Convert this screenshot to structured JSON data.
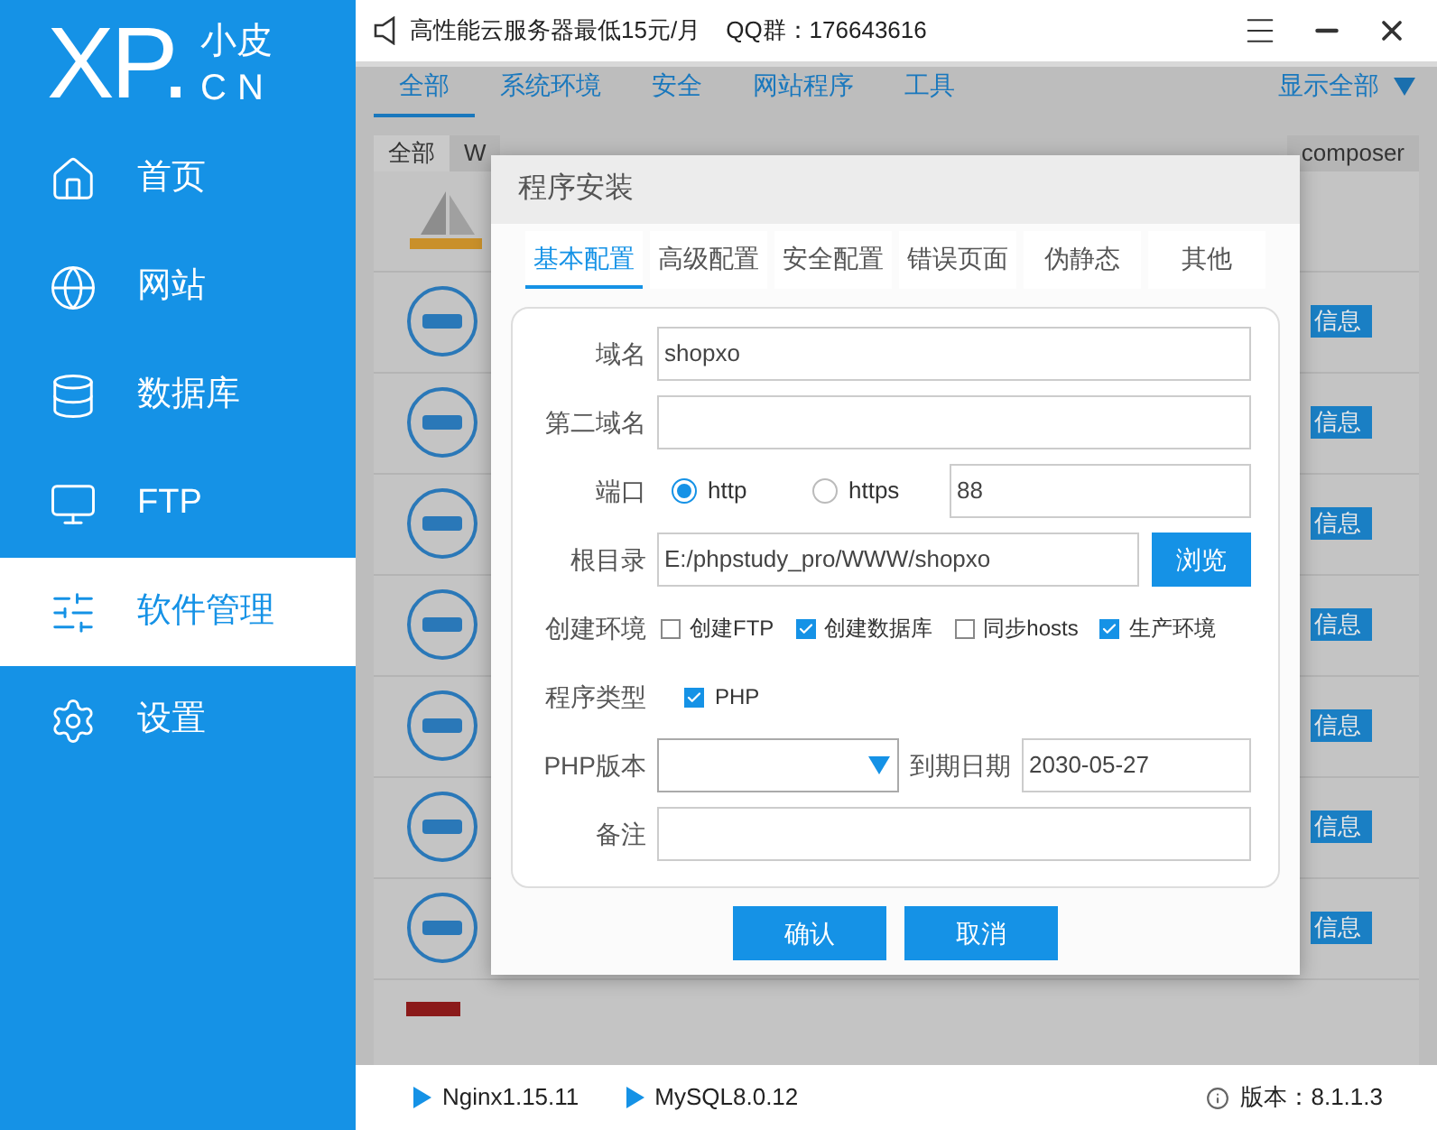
{
  "sidebar": {
    "logo": {
      "mark": "XP.",
      "top": "小皮",
      "bottom": "CN"
    },
    "items": [
      {
        "label": "首页",
        "selected": false
      },
      {
        "label": "网站",
        "selected": false
      },
      {
        "label": "数据库",
        "selected": false
      },
      {
        "label": "FTP",
        "selected": false
      },
      {
        "label": "软件管理",
        "selected": true
      },
      {
        "label": "设置",
        "selected": false
      }
    ]
  },
  "header": {
    "notice": "高性能云服务器最低15元/月",
    "qq": "QQ群：176643616"
  },
  "category_tabs": [
    {
      "label": "全部",
      "selected": true
    },
    {
      "label": "系统环境",
      "selected": false
    },
    {
      "label": "安全",
      "selected": false
    },
    {
      "label": "网站程序",
      "selected": false
    },
    {
      "label": "工具",
      "selected": false
    }
  ],
  "show_all": "显示全部",
  "sub_tabs": [
    {
      "label": "全部",
      "selected": true
    },
    {
      "label": "W",
      "selected": false
    },
    {
      "label": "composer",
      "selected": false
    }
  ],
  "app_rows": [
    {
      "kind": "yadmin"
    },
    {
      "kind": "cms",
      "action": "信息"
    },
    {
      "kind": "cms",
      "action": "信息"
    },
    {
      "kind": "cms",
      "action": "信息"
    },
    {
      "kind": "cms",
      "action": "信息"
    },
    {
      "kind": "cms",
      "action": "信息"
    },
    {
      "kind": "cms",
      "action": "信息"
    },
    {
      "kind": "cms",
      "action": "信息"
    },
    {
      "kind": "red"
    }
  ],
  "dialog": {
    "title": "程序安装",
    "tabs": [
      {
        "label": "基本配置",
        "selected": true
      },
      {
        "label": "高级配置",
        "selected": false
      },
      {
        "label": "安全配置",
        "selected": false
      },
      {
        "label": "错误页面",
        "selected": false
      },
      {
        "label": "伪静态",
        "selected": false
      },
      {
        "label": "其他",
        "selected": false
      }
    ],
    "domain": {
      "label": "域名",
      "value": "shopxo"
    },
    "second_domain": {
      "label": "第二域名"
    },
    "port": {
      "label": "端口",
      "options": [
        {
          "label": "http",
          "selected": true
        },
        {
          "label": "https",
          "selected": false
        }
      ],
      "value": "88"
    },
    "root": {
      "label": "根目录",
      "value": "E:/phpstudy_pro/WWW/shopxo",
      "browse": "浏览"
    },
    "environment": {
      "label": "创建环境",
      "options": [
        {
          "label": "创建FTP",
          "checked": false
        },
        {
          "label": "创建数据库",
          "checked": true
        },
        {
          "label": "同步hosts",
          "checked": false
        },
        {
          "label": "生产环境",
          "checked": true
        }
      ]
    },
    "program_type": {
      "label": "程序类型",
      "options": [
        {
          "label": "PHP",
          "checked": true
        }
      ]
    },
    "php_version": {
      "label": "PHP版本"
    },
    "expiry": {
      "label": "到期日期",
      "value": "2030-05-27"
    },
    "note": {
      "label": "备注"
    },
    "buttons": [
      "确认",
      "取消"
    ]
  },
  "status_bar": {
    "services": [
      "Nginx1.15.11",
      "MySQL8.0.12"
    ],
    "version": "版本：8.1.1.3"
  }
}
